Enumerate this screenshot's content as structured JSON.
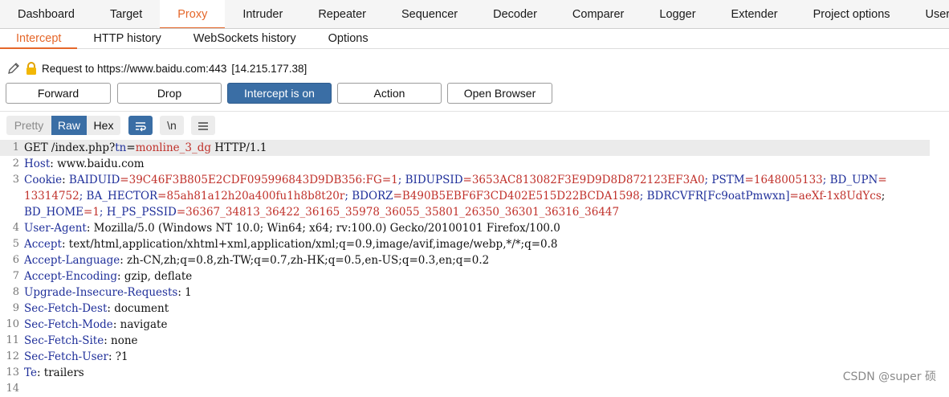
{
  "top_tabs": [
    "Dashboard",
    "Target",
    "Proxy",
    "Intruder",
    "Repeater",
    "Sequencer",
    "Decoder",
    "Comparer",
    "Logger",
    "Extender",
    "Project options",
    "User options"
  ],
  "sub_tabs": [
    "Intercept",
    "HTTP history",
    "WebSockets history",
    "Options"
  ],
  "request_info": {
    "label": "Request to https://www.baidu.com:443",
    "ip": "[14.215.177.38]"
  },
  "buttons": {
    "forward": "Forward",
    "drop": "Drop",
    "intercept": "Intercept is on",
    "action": "Action",
    "open_browser": "Open Browser"
  },
  "view_modes": {
    "pretty": "Pretty",
    "raw": "Raw",
    "hex": "Hex"
  },
  "toolbar": {
    "newline_toggle": "\\n"
  },
  "request": {
    "line1": {
      "method_path": "GET /index.php?",
      "key": "tn",
      "eq": "=",
      "value": "monline_3_dg",
      "proto": " HTTP/1.1"
    },
    "headers": [
      {
        "n": "2",
        "key": "Host",
        "value": ": www.baidu.com"
      },
      {
        "n": "4",
        "key": "User-Agent",
        "value": ": Mozilla/5.0 (Windows NT 10.0; Win64; x64; rv:100.0) Gecko/20100101 Firefox/100.0"
      },
      {
        "n": "5",
        "key": "Accept",
        "value": ": text/html,application/xhtml+xml,application/xml;q=0.9,image/avif,image/webp,*/*;q=0.8"
      },
      {
        "n": "6",
        "key": "Accept-Language",
        "value": ": zh-CN,zh;q=0.8,zh-TW;q=0.7,zh-HK;q=0.5,en-US;q=0.3,en;q=0.2"
      },
      {
        "n": "7",
        "key": "Accept-Encoding",
        "value": ": gzip, deflate"
      },
      {
        "n": "8",
        "key": "Upgrade-Insecure-Requests",
        "value": ": 1"
      },
      {
        "n": "9",
        "key": "Sec-Fetch-Dest",
        "value": ": document"
      },
      {
        "n": "10",
        "key": "Sec-Fetch-Mode",
        "value": ": navigate"
      },
      {
        "n": "11",
        "key": "Sec-Fetch-Site",
        "value": ": none"
      },
      {
        "n": "12",
        "key": "Sec-Fetch-User",
        "value": ": ?1"
      },
      {
        "n": "13",
        "key": "Te",
        "value": ": trailers"
      }
    ],
    "cookie": {
      "key": "Cookie",
      "pairs": [
        {
          "k": " BAIDUID",
          "v": "=39C46F3B805E2CDF095996843D9DB356:FG=1"
        },
        {
          "k": "; BIDUPSID",
          "v": "=3653AC813082F3E9D9D8D872123EF3A0"
        },
        {
          "k": "; PSTM",
          "v": "=1648005133"
        },
        {
          "k": "; BD_UPN",
          "v": "="
        },
        {
          "k": "",
          "v": "13314752"
        },
        {
          "k": "; BA_HECTOR",
          "v": "=85ah81a12h20a400fu1h8b8t20r"
        },
        {
          "k": "; BDORZ",
          "v": "=B490B5EBF6F3CD402E515D22BCDA1598"
        },
        {
          "k": "; BDRCVFR[Fc9oatPmwxn]",
          "v": "=aeXf-1x8UdYcs"
        },
        {
          "k": ";",
          "v": ""
        },
        {
          "k": "BD_HOME",
          "v": "=1"
        },
        {
          "k": "; H_PS_PSSID",
          "v": "=36367_34813_36422_36165_35978_36055_35801_26350_36301_36316_36447"
        }
      ]
    },
    "line14": "14"
  },
  "watermark": "CSDN @super 硕",
  "colors": {
    "accent": "#e5672a",
    "selected": "#3a6ea5",
    "header_key": "#1f2f9a",
    "param_value": "#c0312b"
  }
}
